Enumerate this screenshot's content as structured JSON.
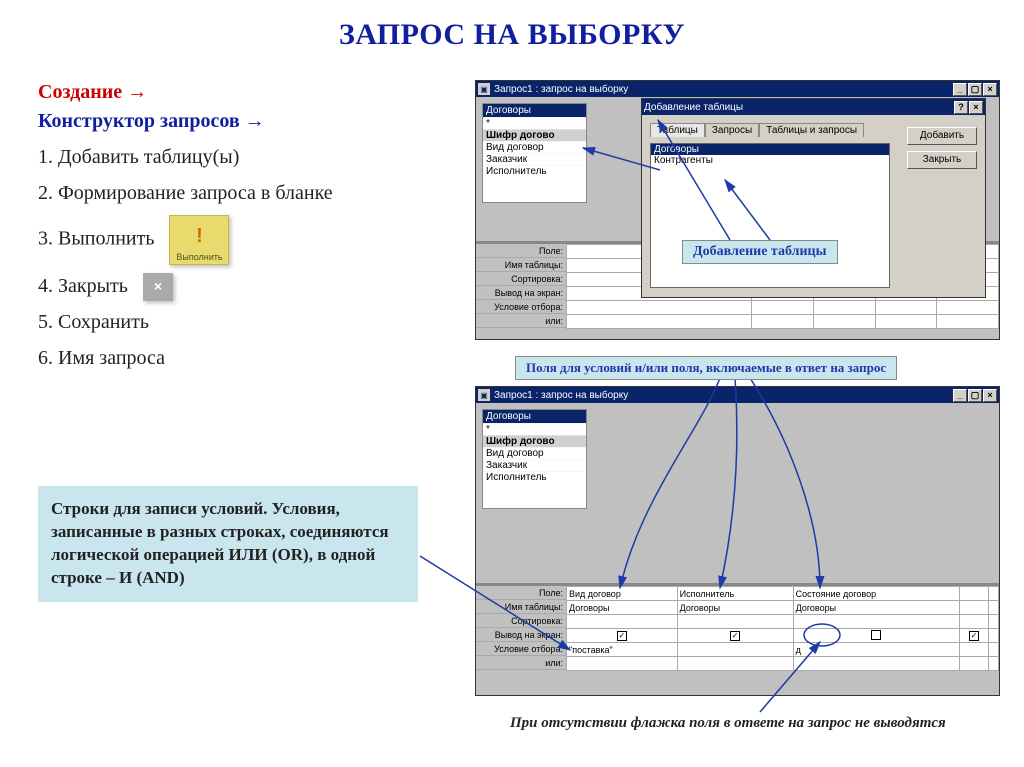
{
  "title": "ЗАПРОС НА ВЫБОРКУ",
  "left": {
    "step_create": "Создание",
    "arrow": "→",
    "step_designer": "Конструктор запросов",
    "items": [
      "1. Добавить таблицу(ы)",
      "2. Формирование запроса в бланке",
      "3. Выполнить",
      "4. Закрыть",
      "5. Сохранить",
      "6. Имя запроса"
    ],
    "btn_execute": "Выполнить",
    "btn_close": "×"
  },
  "note": "Строки для записи условий. Условия, записанные в разных строках, соединяются  логической операцией ИЛИ (OR), в одной строке – И (AND)",
  "callouts": {
    "add_table": "Добавление таблицы",
    "fields_in_answer": "Поля для условий и/или поля, включаемые в ответ на запрос"
  },
  "caption_italic": "При отсутствии флажка поля в ответе на запрос не выводятся",
  "query_window": {
    "title": "Запрос1 : запрос на выборку",
    "table_header": "Договоры",
    "fields": [
      "*",
      "Шифр догово",
      "Вид договор",
      "Заказчик",
      "Исполнитель"
    ],
    "qbe_labels": [
      "Поле:",
      "Имя таблицы:",
      "Сортировка:",
      "Вывод на экран:",
      "Условие отбора:",
      "или:"
    ]
  },
  "dialog": {
    "title": "Добавление таблицы",
    "tabs": [
      "Таблицы",
      "Запросы",
      "Таблицы и запросы"
    ],
    "list": [
      "Договоры",
      "Контрагенты"
    ],
    "btn_add": "Добавить",
    "btn_close": "Закрыть"
  },
  "qbe2": {
    "cols": [
      {
        "field": "Вид договор",
        "table": "Договоры",
        "show": true,
        "cond": "\"поставка\""
      },
      {
        "field": "Исполнитель",
        "table": "Договоры",
        "show": true,
        "cond": ""
      },
      {
        "field": "Состояние договор",
        "table": "Договоры",
        "show": false,
        "cond": "д"
      },
      {
        "field": "",
        "table": "",
        "show": true,
        "cond": ""
      }
    ]
  }
}
